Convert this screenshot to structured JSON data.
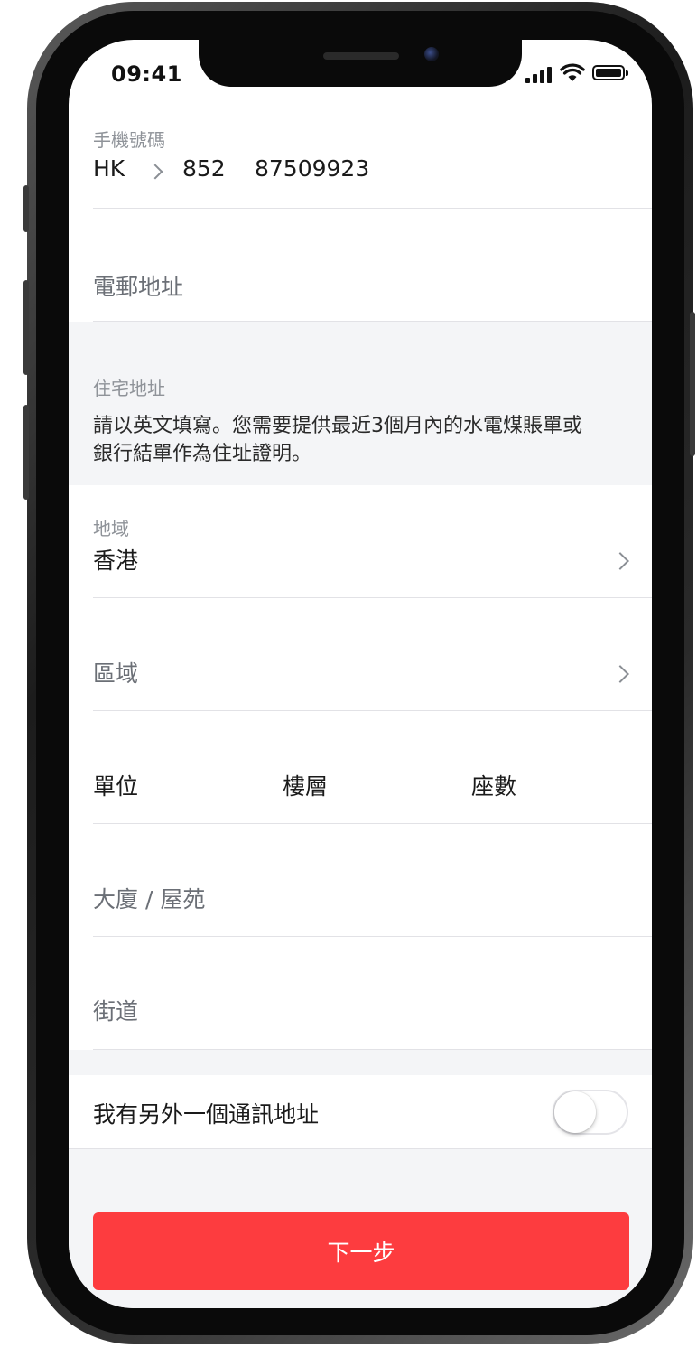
{
  "status_bar": {
    "time": "09:41"
  },
  "phone": {
    "label": "手機號碼",
    "country": "HK",
    "code": "852",
    "number": "87509923"
  },
  "email": {
    "placeholder": "電郵地址"
  },
  "residential": {
    "heading": "住宅地址",
    "note_line1": "請以英文填寫。您需要提供最近3個月內的水電煤賬單或",
    "note_line2": "銀行結單作為住址證明。"
  },
  "region": {
    "label": "地域",
    "value": "香港"
  },
  "district": {
    "placeholder": "區域"
  },
  "unit_fields": {
    "unit": "單位",
    "floor": "樓層",
    "block": "座數"
  },
  "building": {
    "placeholder": "大廈 / 屋苑"
  },
  "street": {
    "placeholder": "街道"
  },
  "mailing_toggle": {
    "label": "我有另外一個通訊地址"
  },
  "next_button": {
    "label": "下一步"
  },
  "colors": {
    "accent": "#fd3c3f",
    "section_bg": "#f4f5f7"
  },
  "icons": [
    "chevron-right-icon",
    "signal-icon",
    "wifi-icon",
    "battery-icon"
  ]
}
